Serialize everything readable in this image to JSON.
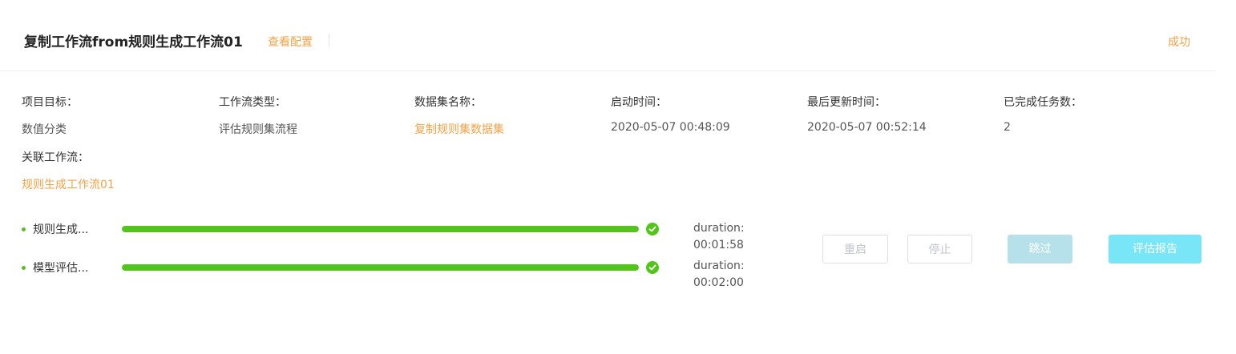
{
  "header": {
    "title": "复制工作流from规则生成工作流01",
    "view_config": "查看配置",
    "status": "成功"
  },
  "info": {
    "project_goal_label": "项目目标：",
    "project_goal_value": "数值分类",
    "workflow_type_label": "工作流类型：",
    "workflow_type_value": "评估规则集流程",
    "dataset_name_label": "数据集名称：",
    "dataset_name_value": "复制规则集数据集",
    "start_time_label": "启动时间：",
    "start_time_value": "2020-05-07 00:48:09",
    "last_update_label": "最后更新时间：",
    "last_update_value": "2020-05-07 00:52:14",
    "completed_tasks_label": "已完成任务数：",
    "completed_tasks_value": "2",
    "related_workflow_label": "关联工作流：",
    "related_workflow_value": "规则生成工作流01"
  },
  "stages": [
    {
      "name": "规则生成...",
      "progress": 1.0,
      "status": "done",
      "duration_label": "duration:",
      "duration_value": "00:01:58"
    },
    {
      "name": "模型评估...",
      "progress": 1.0,
      "status": "done",
      "duration_label": "duration:",
      "duration_value": "00:02:00"
    }
  ],
  "actions": {
    "restart": "重启",
    "stop": "停止",
    "skip": "跳过",
    "report": "评估报告"
  },
  "colors": {
    "accent_orange": "#f5a246",
    "success_green": "#52c41a",
    "skip_button": "#b6e1ea",
    "report_button": "#79e6f7"
  }
}
